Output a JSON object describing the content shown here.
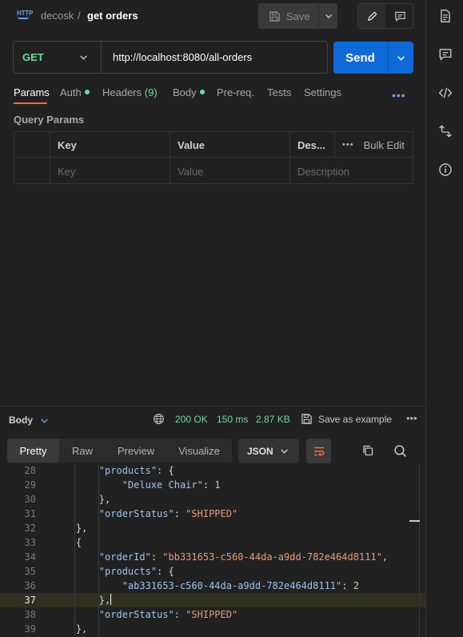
{
  "header": {
    "workspace": "decosk",
    "separator": "/",
    "title": "get orders",
    "save_label": "Save",
    "http_badge": "HTTP"
  },
  "request": {
    "method": "GET",
    "url": "http://localhost:8080/all-orders",
    "send_label": "Send"
  },
  "tabs": [
    {
      "label": "Params"
    },
    {
      "label": "Auth"
    },
    {
      "label": "Headers",
      "count": "(9)"
    },
    {
      "label": "Body"
    },
    {
      "label": "Pre-req."
    },
    {
      "label": "Tests"
    },
    {
      "label": "Settings"
    }
  ],
  "query_params": {
    "title": "Query Params",
    "headers": {
      "key": "Key",
      "value": "Value",
      "description": "Des...",
      "bulk_edit": "Bulk Edit"
    },
    "placeholders": {
      "key": "Key",
      "value": "Value",
      "description": "Description"
    }
  },
  "response": {
    "label": "Body",
    "status": "200 OK",
    "time": "150 ms",
    "size": "2.87 KB",
    "save_example": "Save as example",
    "view_tabs": [
      "Pretty",
      "Raw",
      "Preview",
      "Visualize"
    ],
    "format": "JSON"
  },
  "code_lines": [
    {
      "n": "28",
      "text": "        \"products\": {"
    },
    {
      "n": "29",
      "text": "            \"Deluxe Chair\": 1"
    },
    {
      "n": "30",
      "text": "        },"
    },
    {
      "n": "31",
      "text": "        \"orderStatus\": \"SHIPPED\""
    },
    {
      "n": "32",
      "text": "    },"
    },
    {
      "n": "33",
      "text": "    {"
    },
    {
      "n": "34",
      "text": "        \"orderId\": \"bb331653-c560-44da-a9dd-782e464d8111\","
    },
    {
      "n": "35",
      "text": "        \"products\": {"
    },
    {
      "n": "36",
      "text": "            \"ab331653-c560-44da-a9dd-782e464d8111\": 2"
    },
    {
      "n": "37",
      "text": "        },"
    },
    {
      "n": "38",
      "text": "        \"orderStatus\": \"SHIPPED\""
    },
    {
      "n": "39",
      "text": "    },"
    }
  ],
  "colors": {
    "accent": "#ff6c37",
    "send": "#0e6ad8",
    "success": "#6bdd9a",
    "json_key": "#9cc4f0",
    "json_string": "#e69b7c",
    "json_number": "#b8d7a3"
  }
}
